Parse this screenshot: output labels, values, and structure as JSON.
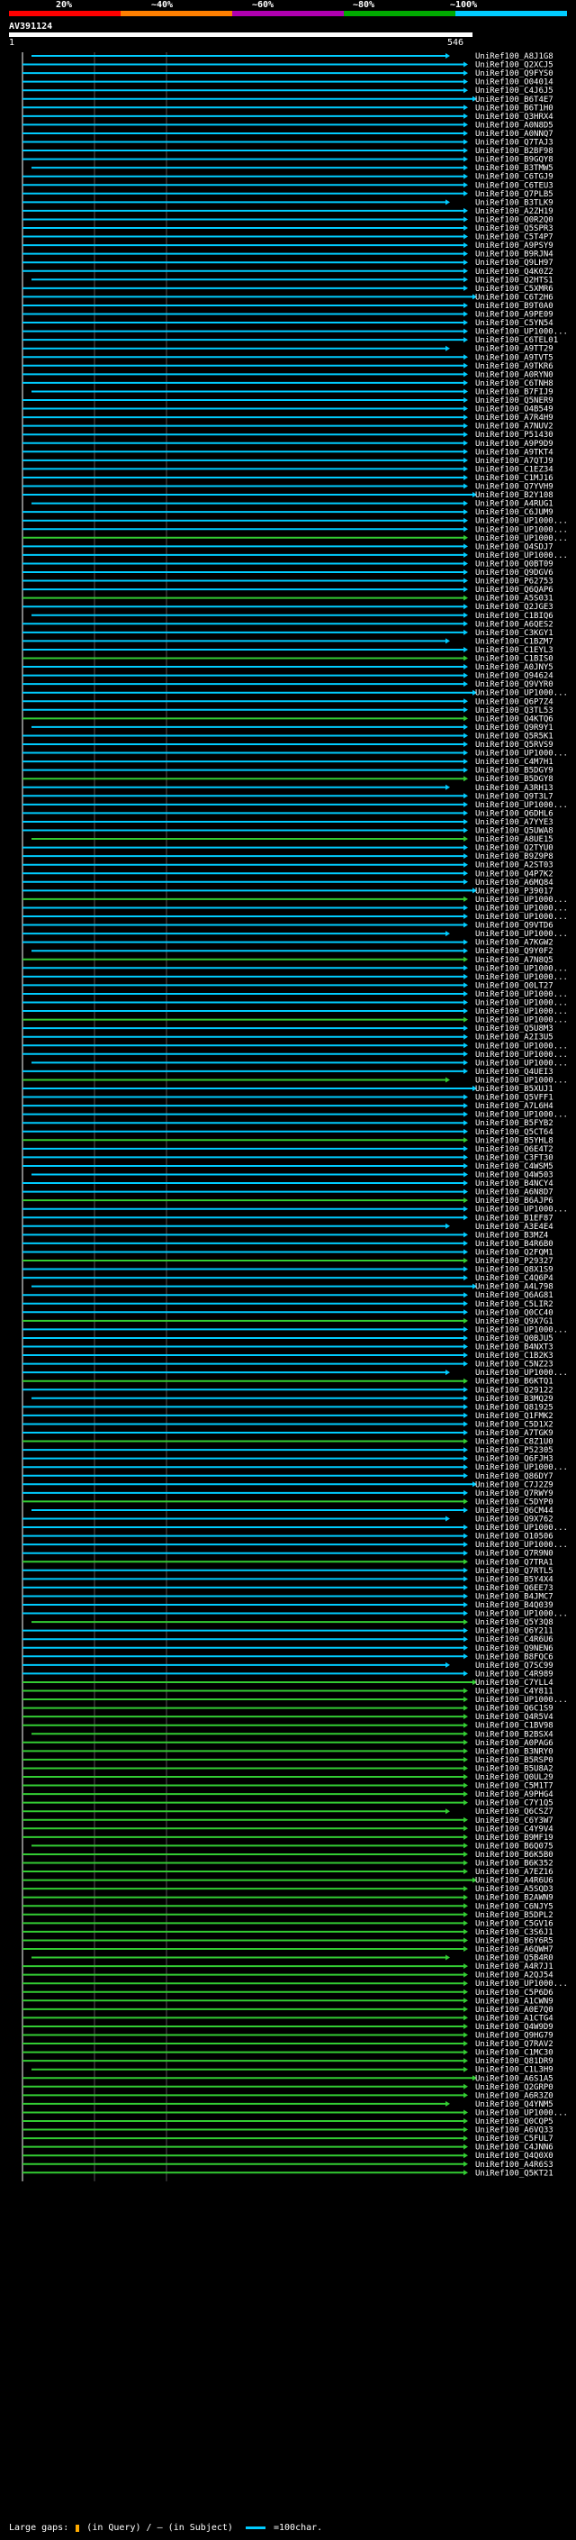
{
  "legend": {
    "labels": [
      "20%",
      "~40%",
      "~60%",
      "~80%",
      "~100%"
    ],
    "colors": [
      "#ff0000",
      "#ff7f00",
      "#b000b0",
      "#00aa00",
      "#00ccff"
    ]
  },
  "query": {
    "name": "AV391124",
    "scale_start": "1",
    "scale_end": "546"
  },
  "footer": {
    "large_gaps_label": "Large gaps:",
    "in_query_label": "(in Query)",
    "separator": "/",
    "in_subject_label": "(in Subject)",
    "scale_label": "=100char."
  },
  "hits": [
    "UniRef100_A8J1G8",
    "UniRef100_Q2XCJ5",
    "UniRef100_Q9FYS0",
    "UniRef100_O04014",
    "UniRef100_C4J6J5",
    "UniRef100_B6T4E7",
    "UniRef100_B6T1H0",
    "UniRef100_Q3HRX4",
    "UniRef100_A0N8D5",
    "UniRef100_A0NNQ7",
    "UniRef100_Q7TAJ3",
    "UniRef100_B2BF98",
    "UniRef100_B9GQY8",
    "UniRef100_B3TMW5",
    "UniRef100_C6TGJ9",
    "UniRef100_C6TEU3",
    "UniRef100_Q7PLB5",
    "UniRef100_B3TLK9",
    "UniRef100_A2ZH19",
    "UniRef100_Q0R2Q0",
    "UniRef100_Q5SPR3",
    "UniRef100_C5T4P7",
    "UniRef100_A9PSY9",
    "UniRef100_B9RJN4",
    "UniRef100_Q9LH97",
    "UniRef100_Q4K0Z2",
    "UniRef100_Q2HTS1",
    "UniRef100_C5XMR6",
    "UniRef100_C6T2H6",
    "UniRef100_B9T0A0",
    "UniRef100_A9PE09",
    "UniRef100_C5YN54",
    "UniRef100_UP1000...",
    "UniRef100_C6TEL01",
    "UniRef100_A9TT29",
    "UniRef100_A9TVT5",
    "UniRef100_A9TKR6",
    "UniRef100_A0RYN0",
    "UniRef100_C6TNH8",
    "UniRef100_B7FIJ9",
    "UniRef100_Q5NER9",
    "UniRef100_O4B549",
    "UniRef100_A7R4H9",
    "UniRef100_A7NUV2",
    "UniRef100_P51430",
    "UniRef100_A9P9D9",
    "UniRef100_A9TKT4",
    "UniRef100_A7QTJ9",
    "UniRef100_C1EZ34",
    "UniRef100_C1MJ16",
    "UniRef100_Q7YVH9",
    "UniRef100_B2Y108",
    "UniRef100_A4RUG1",
    "UniRef100_C6JUM9",
    "UniRef100_UP1000...",
    "UniRef100_UP1000...",
    "UniRef100_UP1000...",
    "UniRef100_Q4SDJ7",
    "UniRef100_UP1000...",
    "UniRef100_Q0BT09",
    "UniRef100_Q9DGV6",
    "UniRef100_P62753",
    "UniRef100_Q6QAP6",
    "UniRef100_A5S031",
    "UniRef100_Q2JGE3",
    "UniRef100_C1BIQ6",
    "UniRef100_A6QES2",
    "UniRef100_C3KGY1",
    "UniRef100_C1BZM7",
    "UniRef100_C1EYL3",
    "UniRef100_C1BIS0",
    "UniRef100_A0JNY5",
    "UniRef100_Q94624",
    "UniRef100_Q9VYR0",
    "UniRef100_UP1000...",
    "UniRef100_Q6P7Z4",
    "UniRef100_Q3TL53",
    "UniRef100_Q4KTQ6",
    "UniRef100_Q9R9Y1",
    "UniRef100_Q5R5K1",
    "UniRef100_Q5RVS9",
    "UniRef100_UP1000...",
    "UniRef100_C4M7H1",
    "UniRef100_B5DGY9",
    "UniRef100_B5DGY8",
    "UniRef100_A3RH13",
    "UniRef100_Q9T3L7",
    "UniRef100_UP1000...",
    "UniRef100_Q6DHL6",
    "UniRef100_A7YYE3",
    "UniRef100_Q5UWA8",
    "UniRef100_A8UE15",
    "UniRef100_Q2TYU0",
    "UniRef100_B9Z9P8",
    "UniRef100_A2ST03",
    "UniRef100_Q4P7K2",
    "UniRef100_A6MQ84",
    "UniRef100_P39017",
    "UniRef100_UP1000...",
    "UniRef100_UP1000...",
    "UniRef100_UP1000...",
    "UniRef100_Q9VTD6",
    "UniRef100_UP1000...",
    "UniRef100_A7KGW2",
    "UniRef100_Q9Y0F2",
    "UniRef100_A7N8Q5",
    "UniRef100_UP1000...",
    "UniRef100_UP1000...",
    "UniRef100_Q0LT27",
    "UniRef100_UP1000...",
    "UniRef100_UP1000...",
    "UniRef100_UP1000...",
    "UniRef100_UP1000...",
    "UniRef100_Q5U8M3",
    "UniRef100_A2I3U5",
    "UniRef100_UP1000...",
    "UniRef100_UP1000...",
    "UniRef100_UP1000...",
    "UniRef100_Q4UEI3",
    "UniRef100_UP1000...",
    "UniRef100_B5XUJ1",
    "UniRef100_Q5VFF1",
    "UniRef100_A7L6H4",
    "UniRef100_UP1000...",
    "UniRef100_B5FYB2",
    "UniRef100_Q5CT64",
    "UniRef100_B5YHL8",
    "UniRef100_Q6E4T2",
    "UniRef100_C3FT30",
    "UniRef100_C4WSM5",
    "UniRef100_Q4W503",
    "UniRef100_B4NCY4",
    "UniRef100_A6N8D7",
    "UniRef100_B6AJP6",
    "UniRef100_UP1000...",
    "UniRef100_B1EF87",
    "UniRef100_A3E4E4",
    "UniRef100_B3MZ4",
    "UniRef100_B4R6B0",
    "UniRef100_Q2FQM1",
    "UniRef100_P29327",
    "UniRef100_Q8X1S9",
    "UniRef100_C4Q6P4",
    "UniRef100_A4L798",
    "UniRef100_Q6AG81",
    "UniRef100_C5LIR2",
    "UniRef100_Q0CC40",
    "UniRef100_Q9X7G1",
    "UniRef100_UP1000...",
    "UniRef100_Q0BJU5",
    "UniRef100_B4NXT3",
    "UniRef100_C1B2K3",
    "UniRef100_C5NZ23",
    "UniRef100_UP1000...",
    "UniRef100_B6KTQ1",
    "UniRef100_Q29122",
    "UniRef100_B3MQ29",
    "UniRef100_Q81925",
    "UniRef100_Q1FMK2",
    "UniRef100_C5D1X2",
    "UniRef100_A7TGK9",
    "UniRef100_C8Z1U0",
    "UniRef100_P52305",
    "UniRef100_Q6FJH3",
    "UniRef100_UP1000...",
    "UniRef100_Q86DY7",
    "UniRef100_C7J2Z9",
    "UniRef100_Q7RWY9",
    "UniRef100_C5DYP0",
    "UniRef100_Q6CM44",
    "UniRef100_Q9X762",
    "UniRef100_UP1000...",
    "UniRef100_O10506",
    "UniRef100_UP1000...",
    "UniRef100_Q7R9N0",
    "UniRef100_Q7TRA1",
    "UniRef100_Q7RTL5",
    "UniRef100_B5Y4X4",
    "UniRef100_Q6EE73",
    "UniRef100_B4JMC7",
    "UniRef100_B4Q039",
    "UniRef100_UP1000...",
    "UniRef100_Q5Y3Q8",
    "UniRef100_Q6Y211",
    "UniRef100_C4R6U6",
    "UniRef100_Q9NEN6",
    "UniRef100_B8FQC6",
    "UniRef100_Q7SC99",
    "UniRef100_C4R989",
    "UniRef100_C7YLL4",
    "UniRef100_C4Y811",
    "UniRef100_UP1000...",
    "UniRef100_Q6C1S9",
    "UniRef100_Q4R5V4",
    "UniRef100_C1BV98",
    "UniRef100_B2BSX4",
    "UniRef100_A0PAG6",
    "UniRef100_B3NRY0",
    "UniRef100_B5RSP0",
    "UniRef100_B5U8A2",
    "UniRef100_Q0UL29",
    "UniRef100_C5M1T7",
    "UniRef100_A9PHG4",
    "UniRef100_C7Y1Q5",
    "UniRef100_Q6CSZ7",
    "UniRef100_C6Y3W7",
    "UniRef100_C4Y9V4",
    "UniRef100_B9MF19",
    "UniRef100_B6Q075",
    "UniRef100_B6K5B0",
    "UniRef100_B6K352",
    "UniRef100_A7EZ16",
    "UniRef100_A4R6U6",
    "UniRef100_A5SQD3",
    "UniRef100_B2AWN9",
    "UniRef100_C6NJY5",
    "UniRef100_B5DPL2",
    "UniRef100_C5GV16",
    "UniRef100_C3S6J1",
    "UniRef100_B6Y6R5",
    "UniRef100_A6QWH7",
    "UniRef100_Q5B4R0",
    "UniRef100_A4R7J1",
    "UniRef100_A2QJ54",
    "UniRef100_UP1000...",
    "UniRef100_C5P6D6",
    "UniRef100_A1CWN9",
    "UniRef100_A0E7Q0",
    "UniRef100_A1CTG4",
    "UniRef100_Q4W9D9",
    "UniRef100_Q9HG79",
    "UniRef100_Q7RAV2",
    "UniRef100_C1MC30",
    "UniRef100_Q81DR9",
    "UniRef100_C1L3H9",
    "UniRef100_A6S1A5",
    "UniRef100_Q2GRP0",
    "UniRef100_A6R3Z0",
    "UniRef100_Q4YNM5",
    "UniRef100_UP1000...",
    "UniRef100_Q0CQP5",
    "UniRef100_A6VQ33",
    "UniRef100_C5FUL7",
    "UniRef100_C4JNN6",
    "UniRef100_Q4Q0X0",
    "UniRef100_A4R6S3",
    "UniRef100_Q5KT21"
  ]
}
